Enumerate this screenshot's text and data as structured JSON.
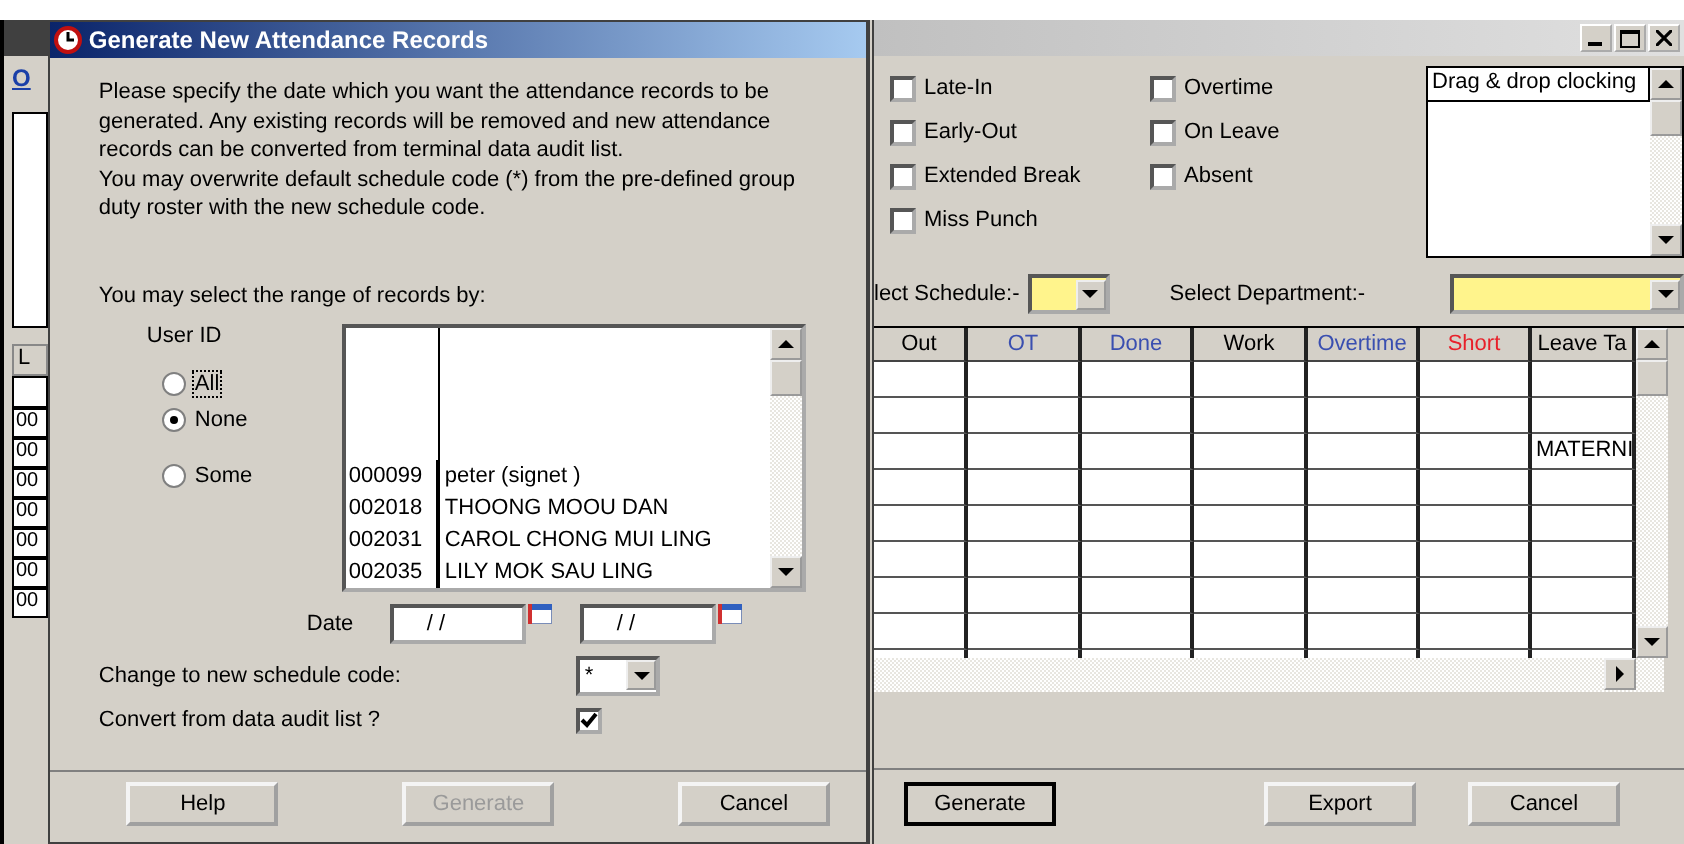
{
  "background_window": {
    "link": "O",
    "column": "L",
    "cells": [
      "00",
      "00",
      "00",
      "00",
      "00",
      "00",
      "00"
    ]
  },
  "dialog": {
    "title": "Generate New Attendance Records",
    "intro": [
      "Please specify the date which you want the attendance records to be",
      "generated. Any existing records will be removed and new attendance",
      "records can be converted from terminal data audit list.",
      "You may overwrite default schedule code (*) from the pre-defined group",
      "duty roster with the new schedule code."
    ],
    "prompt": "You may select the range of records by:",
    "user_id_label": "User ID",
    "radios": [
      {
        "label": "All",
        "selected": false
      },
      {
        "label": "None",
        "selected": true
      },
      {
        "label": "Some",
        "selected": false
      }
    ],
    "users": [
      {
        "id": "000099",
        "name": "peter (signet )"
      },
      {
        "id": "002018",
        "name": "THOONG MOOU DAN"
      },
      {
        "id": "002031",
        "name": "CAROL CHONG MUI LING"
      },
      {
        "id": "002035",
        "name": "LILY MOK SAU LING"
      }
    ],
    "date_label": "Date",
    "dates": [
      "/ /",
      "/ /"
    ],
    "schedule_label": "Change to new schedule code:",
    "schedule_value": "*",
    "convert_label": "Convert from data audit list ?",
    "convert_checked": true,
    "buttons": [
      {
        "label": "Help",
        "disabled": false
      },
      {
        "label": "Generate",
        "disabled": true
      },
      {
        "label": "Cancel",
        "disabled": false
      }
    ]
  },
  "main_window": {
    "filters": [
      {
        "label": "Late-In",
        "checked": false
      },
      {
        "label": "Early-Out",
        "checked": false
      },
      {
        "label": "Extended Break",
        "checked": false
      },
      {
        "label": "Miss Punch",
        "checked": false
      },
      {
        "label": "Overtime",
        "checked": false
      },
      {
        "label": "On Leave",
        "checked": false
      },
      {
        "label": "Absent",
        "checked": false
      }
    ],
    "clocking_header": "Drag & drop clocking",
    "schedule_label": "lect Schedule:-",
    "department_label": "Select Department:-",
    "columns": [
      {
        "label": "Out",
        "color": "#000000"
      },
      {
        "label": "OT",
        "color": "#3a4fb0"
      },
      {
        "label": "Done",
        "color": "#3a4fb0"
      },
      {
        "label": "Work",
        "color": "#000000"
      },
      {
        "label": "Overtime",
        "color": "#3a4fb0"
      },
      {
        "label": "Short",
        "color": "#e8202a"
      },
      {
        "label": "Leave Ta",
        "color": "#000000"
      }
    ],
    "rows": [
      [
        "",
        "",
        "",
        "",
        "",
        "",
        ""
      ],
      [
        "",
        "",
        "",
        "",
        "",
        "",
        ""
      ],
      [
        "",
        "",
        "",
        "",
        "",
        "",
        "MATERNI"
      ],
      [
        "",
        "",
        "",
        "",
        "",
        "",
        ""
      ],
      [
        "",
        "",
        "",
        "",
        "",
        "",
        ""
      ],
      [
        "",
        "",
        "",
        "",
        "",
        "",
        ""
      ],
      [
        "",
        "",
        "",
        "",
        "",
        "",
        ""
      ],
      [
        "",
        "",
        "",
        "",
        "",
        "",
        ""
      ],
      [
        "",
        "",
        "",
        "",
        "",
        "",
        ""
      ]
    ],
    "buttons": [
      "Generate",
      "Export",
      "Cancel"
    ]
  }
}
